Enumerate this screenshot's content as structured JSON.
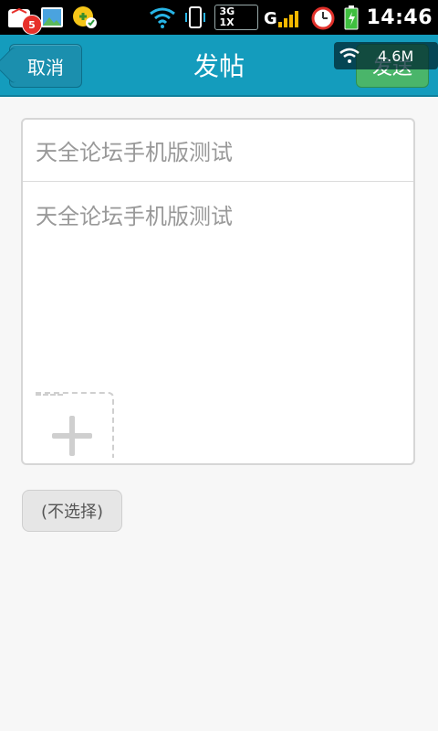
{
  "status_bar": {
    "notification_count": "5",
    "network": "3G",
    "network_alt": "1X",
    "time": "14:46"
  },
  "header": {
    "cancel_label": "取消",
    "title": "发帖",
    "send_label": "发送",
    "speed": "4.6M"
  },
  "form": {
    "title_placeholder": "天全论坛手机版测试",
    "body_placeholder": "天全论坛手机版测试"
  },
  "category_select": {
    "label": "(不选择)"
  },
  "colors": {
    "accent": "#149cbd",
    "send": "#4ab56a"
  },
  "icons": [
    "app-icon",
    "gallery-icon",
    "plugin-icon",
    "wifi-icon",
    "vibrate-icon",
    "signal-icon",
    "alarm-icon",
    "battery-icon",
    "add-image-icon"
  ]
}
